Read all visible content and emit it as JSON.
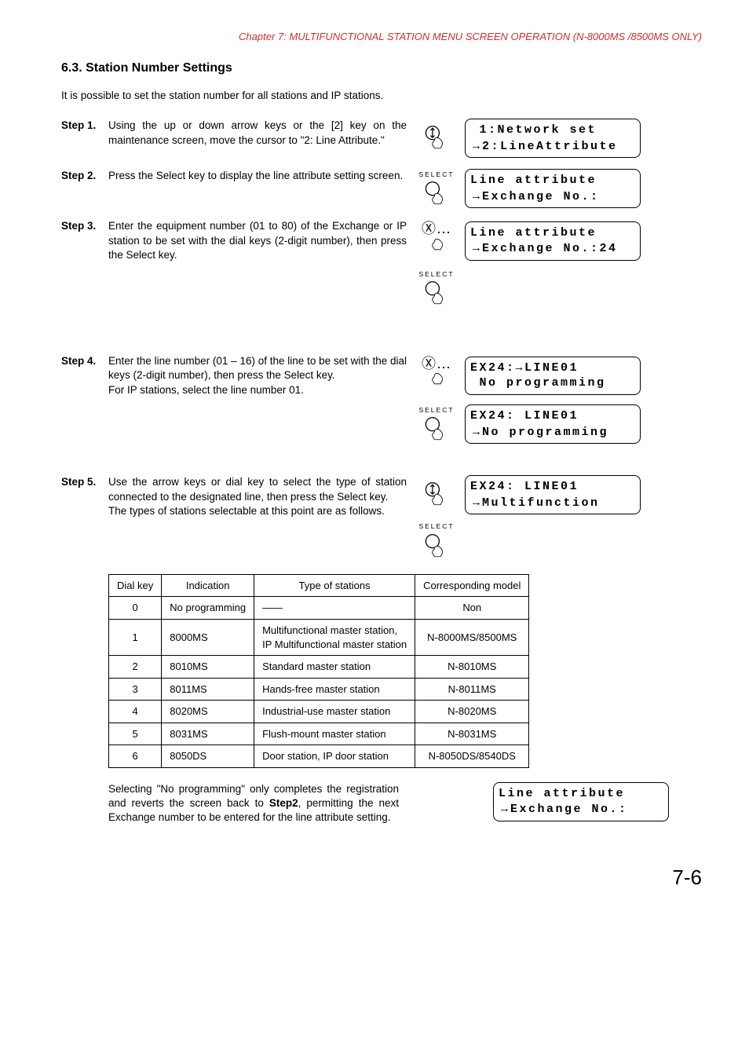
{
  "chapterHeader": "Chapter 7:  MULTIFUNCTIONAL STATION MENU SCREEN OPERATION (N-8000MS /8500MS ONLY)",
  "sectionTitle": "6.3. Station Number Settings",
  "intro": "It is possible to set the station number for all stations and IP stations.",
  "selectLabel": "SELECT",
  "steps": {
    "s1": {
      "label": "Step 1.",
      "body": "Using the up or down arrow keys or the [2] key on the maintenance screen, move the cursor to \"2: Line Attribute.\""
    },
    "s2": {
      "label": "Step 2.",
      "body": "Press the Select key to display the line attribute setting screen."
    },
    "s3": {
      "label": "Step 3.",
      "body": "Enter the equipment number (01 to 80) of the Exchange or IP station to be set with the dial keys (2-digit number), then press the Select key."
    },
    "s4": {
      "label": "Step 4.",
      "body": "Enter the line number (01 – 16) of the line to be set with the dial keys (2-digit number), then press the Select key.",
      "body2": "For IP stations, select the line number 01."
    },
    "s5": {
      "label": "Step 5.",
      "body": "Use the arrow keys or dial key to select the type of station connected to the designated line, then press the Select key.",
      "body2": "The types of stations selectable at this point are as follows."
    }
  },
  "lcd": {
    "l1a": " 1:Network set",
    "l1b": "2:LineAttribute",
    "l2a": "Line attribute",
    "l2b": "Exchange No.:",
    "l3a": "Line attribute",
    "l3b": "Exchange No.:24",
    "l4a": "EX24:→LINE01",
    "l4b": " No programming",
    "l5a": "EX24: LINE01",
    "l5b": "No programming",
    "l6a": "EX24: LINE01",
    "l6b": "Multifunction",
    "l7a": "Line attribute",
    "l7b": "Exchange No.:"
  },
  "tableHeaders": {
    "h1": "Dial key",
    "h2": "Indication",
    "h3": "Type of stations",
    "h4": "Corresponding model"
  },
  "tableRows": [
    {
      "c1": "0",
      "c2": "No programming",
      "c3": "——",
      "c4": "Non"
    },
    {
      "c1": "1",
      "c2": "8000MS",
      "c3": "Multifunctional master station,\nIP Multifunctional master station",
      "c4": "N-8000MS/8500MS"
    },
    {
      "c1": "2",
      "c2": "8010MS",
      "c3": "Standard master station",
      "c4": "N-8010MS"
    },
    {
      "c1": "3",
      "c2": "8011MS",
      "c3": "Hands-free master station",
      "c4": "N-8011MS"
    },
    {
      "c1": "4",
      "c2": "8020MS",
      "c3": "Industrial-use master station",
      "c4": "N-8020MS"
    },
    {
      "c1": "5",
      "c2": "8031MS",
      "c3": "Flush-mount master station",
      "c4": "N-8031MS"
    },
    {
      "c1": "6",
      "c2": "8050DS",
      "c3": "Door station, IP door station",
      "c4": "N-8050DS/8540DS"
    }
  ],
  "bottomText1": "Selecting \"No programming\" only completes the registration and reverts the screen back to ",
  "bottomTextBold": "Step2",
  "bottomText2": ", permitting the next Exchange number to be entered for the line attribute setting.",
  "pageNum": "7-6",
  "chart_data": {
    "type": "table",
    "title": "Station type dial key mapping",
    "columns": [
      "Dial key",
      "Indication",
      "Type of stations",
      "Corresponding model"
    ],
    "rows": [
      [
        "0",
        "No programming",
        "——",
        "Non"
      ],
      [
        "1",
        "8000MS",
        "Multifunctional master station, IP Multifunctional master station",
        "N-8000MS/8500MS"
      ],
      [
        "2",
        "8010MS",
        "Standard master station",
        "N-8010MS"
      ],
      [
        "3",
        "8011MS",
        "Hands-free master station",
        "N-8011MS"
      ],
      [
        "4",
        "8020MS",
        "Industrial-use master station",
        "N-8020MS"
      ],
      [
        "5",
        "8031MS",
        "Flush-mount master station",
        "N-8031MS"
      ],
      [
        "6",
        "8050DS",
        "Door station, IP door station",
        "N-8050DS/8540DS"
      ]
    ]
  }
}
